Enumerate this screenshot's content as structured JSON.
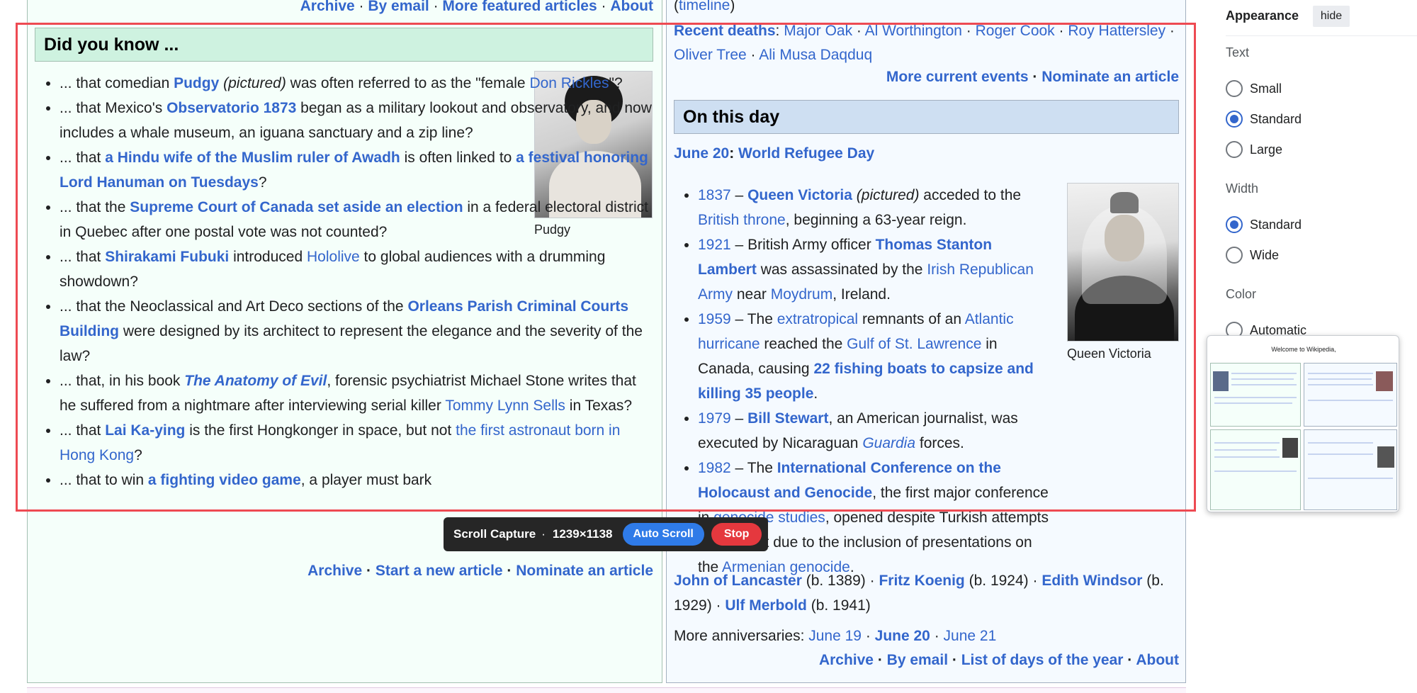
{
  "left_top_links": [
    "Archive",
    "By email",
    "More featured articles",
    "About"
  ],
  "dyk": {
    "heading": "Did you know ...",
    "image_caption": "Pudgy",
    "items": [
      [
        {
          "t": "... that comedian "
        },
        {
          "t": "Pudgy",
          "link": true,
          "bold": true
        },
        {
          "t": " "
        },
        {
          "t": "(pictured)",
          "italic": true
        },
        {
          "t": " was often referred to as the \"female "
        },
        {
          "t": "Don Rickles",
          "link": true
        },
        {
          "t": "\"?"
        }
      ],
      [
        {
          "t": "... that Mexico's "
        },
        {
          "t": "Observatorio 1873",
          "link": true,
          "bold": true
        },
        {
          "t": " began as a military lookout and observatory, and now includes a whale museum, an iguana sanctuary and a zip line?"
        }
      ],
      [
        {
          "t": "... that "
        },
        {
          "t": "a Hindu wife of the Muslim ruler of Awadh",
          "link": true,
          "bold": true
        },
        {
          "t": " is often linked to "
        },
        {
          "t": "a festival honoring Lord Hanuman on Tuesdays",
          "link": true,
          "bold": true
        },
        {
          "t": "?"
        }
      ],
      [
        {
          "t": "... that the "
        },
        {
          "t": "Supreme Court of Canada set aside an election",
          "link": true,
          "bold": true
        },
        {
          "t": " in a federal electoral district in Quebec after one postal vote was not counted?"
        }
      ],
      [
        {
          "t": "... that "
        },
        {
          "t": "Shirakami Fubuki",
          "link": true,
          "bold": true
        },
        {
          "t": " introduced "
        },
        {
          "t": "Hololive",
          "link": true
        },
        {
          "t": " to global audiences with a drumming showdown?"
        }
      ],
      [
        {
          "t": "... that the Neoclassical and Art Deco sections of the "
        },
        {
          "t": "Orleans Parish Criminal Courts Building",
          "link": true,
          "bold": true
        },
        {
          "t": " were designed by its architect to represent the elegance and the severity of the law?"
        }
      ],
      [
        {
          "t": "... that, in his book "
        },
        {
          "t": "The Anatomy of Evil",
          "link": true,
          "bold": true,
          "italic": true
        },
        {
          "t": ", forensic psychiatrist Michael Stone writes that he suffered from a nightmare after interviewing serial killer "
        },
        {
          "t": "Tommy Lynn Sells",
          "link": true
        },
        {
          "t": " in Texas?"
        }
      ],
      [
        {
          "t": "... that "
        },
        {
          "t": "Lai Ka-ying",
          "link": true,
          "bold": true
        },
        {
          "t": " is the first Hongkonger in space, but not "
        },
        {
          "t": "the first astronaut born in Hong Kong",
          "link": true
        },
        {
          "t": "?"
        }
      ],
      [
        {
          "t": "... that to win "
        },
        {
          "t": "a fighting video game",
          "link": true,
          "bold": true
        },
        {
          "t": ", a player must bark"
        }
      ]
    ],
    "footer_links": [
      "Archive",
      "Start a new article",
      "Nominate an article"
    ]
  },
  "itn": {
    "timeline_open": "(",
    "timeline": "timeline",
    "timeline_close": ")",
    "recent_deaths_label": "Recent deaths",
    "recent_deaths": [
      "Major Oak",
      "Al Worthington",
      "Roger Cook",
      "Roy Hattersley",
      "Oliver Tree",
      "Ali Musa Daqduq"
    ],
    "footer_links": [
      "More current events",
      "Nominate an article"
    ]
  },
  "otd": {
    "heading": "On this day",
    "date": "June 20",
    "observance": "World Refugee Day",
    "image_caption": "Queen Victoria",
    "events": [
      [
        {
          "t": "1837",
          "link": true
        },
        {
          "t": " – "
        },
        {
          "t": "Queen Victoria",
          "link": true,
          "bold": true
        },
        {
          "t": " "
        },
        {
          "t": "(pictured)",
          "italic": true
        },
        {
          "t": " acceded to the "
        },
        {
          "t": "British throne",
          "link": true
        },
        {
          "t": ", beginning a 63-year reign."
        }
      ],
      [
        {
          "t": "1921",
          "link": true
        },
        {
          "t": " – British Army officer "
        },
        {
          "t": "Thomas Stanton Lambert",
          "link": true,
          "bold": true
        },
        {
          "t": " was assassinated by the "
        },
        {
          "t": "Irish Republican Army",
          "link": true
        },
        {
          "t": " near "
        },
        {
          "t": "Moydrum",
          "link": true
        },
        {
          "t": ", Ireland."
        }
      ],
      [
        {
          "t": "1959",
          "link": true
        },
        {
          "t": " – The "
        },
        {
          "t": "extratropical",
          "link": true
        },
        {
          "t": " remnants of an "
        },
        {
          "t": "Atlantic hurricane",
          "link": true
        },
        {
          "t": " reached the "
        },
        {
          "t": "Gulf of St. Lawrence",
          "link": true
        },
        {
          "t": " in Canada, causing "
        },
        {
          "t": "22 fishing boats to capsize and killing 35 people",
          "link": true,
          "bold": true
        },
        {
          "t": "."
        }
      ],
      [
        {
          "t": "1979",
          "link": true
        },
        {
          "t": " – "
        },
        {
          "t": "Bill Stewart",
          "link": true,
          "bold": true
        },
        {
          "t": ", an American journalist, was executed by Nicaraguan "
        },
        {
          "t": "Guardia",
          "link": true,
          "italic": true
        },
        {
          "t": " forces."
        }
      ],
      [
        {
          "t": "1982",
          "link": true
        },
        {
          "t": " – The "
        },
        {
          "t": "International Conference on the Holocaust and Genocide",
          "link": true,
          "bold": true
        },
        {
          "t": ", the first major conference in "
        },
        {
          "t": "genocide studies",
          "link": true
        },
        {
          "t": ", opened despite Turkish attempts to cancel it due to the inclusion of presentations on the "
        },
        {
          "t": "Armenian genocide",
          "link": true
        },
        {
          "t": "."
        }
      ]
    ],
    "births": [
      [
        {
          "t": "John of Lancaster",
          "link": true,
          "bold": true
        },
        {
          "t": " (b. 1389) · "
        },
        {
          "t": "Fritz Koenig",
          "link": true,
          "bold": true
        },
        {
          "t": " (b. 1924) · "
        },
        {
          "t": "Edith Windsor",
          "link": true,
          "bold": true
        },
        {
          "t": " (b. 1929) · "
        },
        {
          "t": "Ulf Merbold",
          "link": true,
          "bold": true
        },
        {
          "t": " (b. 1941)"
        }
      ]
    ],
    "more_anniversaries_label": "More anniversaries:",
    "more_anniversaries": [
      "June 19",
      "June 20",
      "June 21"
    ],
    "footer_links": [
      "Archive",
      "By email",
      "List of days of the year",
      "About"
    ]
  },
  "appearance": {
    "title": "Appearance",
    "hide": "hide",
    "text_label": "Text",
    "text_options": [
      "Small",
      "Standard",
      "Large"
    ],
    "text_selected": "Standard",
    "width_label": "Width",
    "width_options": [
      "Standard",
      "Wide"
    ],
    "width_selected": "Standard",
    "color_label": "Color",
    "color_options": [
      "Automatic"
    ]
  },
  "capture": {
    "title": "Scroll Capture",
    "separator": "·",
    "size": "1239×1138",
    "auto_scroll": "Auto Scroll",
    "stop": "Stop"
  },
  "thumbnail": {
    "title": "Welcome to Wikipedia,"
  },
  "colors": {
    "link": "#3366cc",
    "dyk_bg": "#f5fffa",
    "dyk_header": "#cef2e0",
    "otd_bg": "#f5faff",
    "otd_header": "#cedff2",
    "capture_border": "#ee4a52",
    "auto_scroll": "#2f7be8",
    "stop": "#e5383e"
  }
}
